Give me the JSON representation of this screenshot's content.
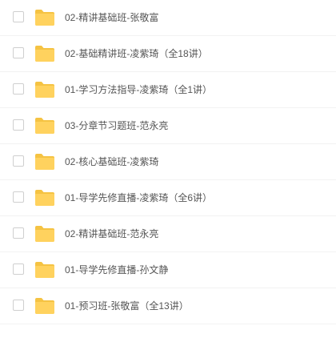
{
  "files": [
    {
      "name": "02-精讲基础班-张敬富"
    },
    {
      "name": "02-基础精讲班-凌紫琦（全18讲）"
    },
    {
      "name": "01-学习方法指导-凌紫琦（全1讲）"
    },
    {
      "name": "03-分章节习题班-范永亮"
    },
    {
      "name": "02-核心基础班-凌紫琦"
    },
    {
      "name": "01-导学先修直播-凌紫琦（全6讲）"
    },
    {
      "name": "02-精讲基础班-范永亮"
    },
    {
      "name": "01-导学先修直播-孙文静"
    },
    {
      "name": "01-预习班-张敬富（全13讲）"
    }
  ],
  "colors": {
    "folder": "#FFD25E",
    "folder_tab": "#F5C343",
    "text": "#555555",
    "checkbox_border": "#CFCFCF"
  },
  "icons": {
    "item": "folder-icon"
  }
}
